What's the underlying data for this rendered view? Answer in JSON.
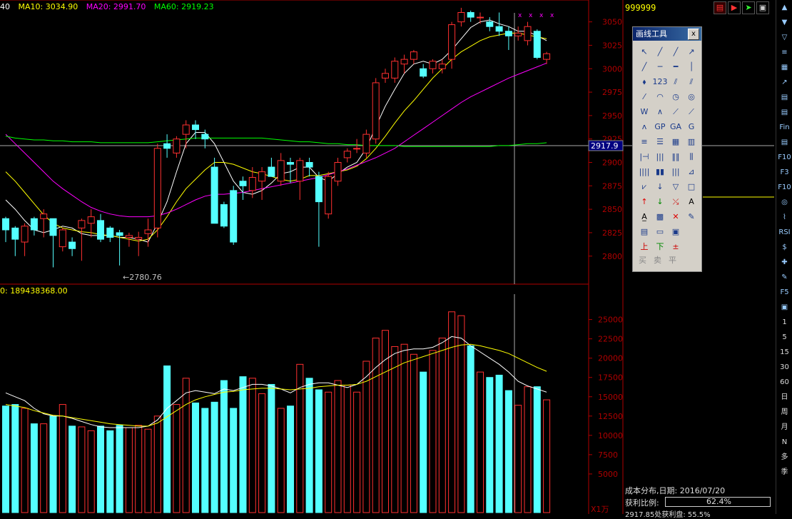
{
  "legend": {
    "ma5": "40",
    "ma10": "MA10: 3034.90",
    "ma20": "MA20: 2991.70",
    "ma60": "MA60: 2919.23"
  },
  "volume_legend": "0: 189438368.00",
  "code": "999999",
  "low_marker": "←2780.76",
  "crosshair_price": "2917.9",
  "colors": {
    "up": "#ff3030",
    "down": "#54ffff",
    "ma5": "#ffffff",
    "ma10": "#ffff00",
    "ma20": "#ff00ff",
    "ma60": "#00ff00",
    "axis": "#b00000"
  },
  "price_axis": [
    "3050",
    "3025",
    "3000",
    "2975",
    "2950",
    "2925",
    "2900",
    "2875",
    "2850",
    "2825",
    "2800"
  ],
  "volume_axis": [
    "25000",
    "22500",
    "20000",
    "17500",
    "15000",
    "12500",
    "10000",
    "7500",
    "5000"
  ],
  "volume_unit": "X1万",
  "drawtool": {
    "title": "画线工具",
    "close": "x",
    "tools": [
      "select-arrow",
      "line",
      "ray",
      "arrow-line",
      "segment",
      "h-line",
      "h-ray",
      "v-line",
      "point",
      "price-123",
      "parallel-lines",
      "parallel-channel",
      "dashed-line",
      "arc",
      "circle",
      "ellipse",
      "wave",
      "zigzag",
      "trend",
      "polyline",
      "wave-m",
      "gp",
      "ga",
      "gx",
      "fibo-retrace",
      "fibo-levels",
      "gann-fan",
      "gann-box",
      "time-cycle",
      "period-lines",
      "fibo-time",
      "fibo-fan",
      "bars",
      "barcode",
      "comb",
      "line-fan",
      "fan-lines",
      "down-arrow",
      "triangle",
      "rectangle",
      "up-arrow",
      "down-green-arrow",
      "flag-arrows",
      "text",
      "text-box",
      "block",
      "delete",
      "paint",
      "note",
      "panel",
      "picture",
      "blank",
      "buy-mark",
      "sell-mark",
      "equal-mark",
      "blank2"
    ],
    "labels": {
      "text": "A",
      "delete": "✕",
      "buy": "买",
      "sell": "卖",
      "flat": "平"
    }
  },
  "sidebar": [
    "▲",
    "▼",
    "▽",
    "≡",
    "▦",
    "↗",
    "▤",
    "▤",
    "Fin",
    "▤",
    "F10",
    "F3",
    "F10",
    "◎",
    "⌇",
    "RSI",
    "$",
    "✚",
    "✎",
    "F5",
    "▣",
    "1",
    "5",
    "15",
    "30",
    "60",
    "日",
    "周",
    "月",
    "N",
    "多",
    "季"
  ],
  "cost_info": {
    "label": "成本分布,日期: 2016/07/20",
    "ratio_label": "获利比例:",
    "ratio_value": "62.4%",
    "ratio_fraction": 0.624,
    "profit_line": "2917.85处获利盘: 55.5%"
  },
  "chart_data": {
    "type": "candlestick",
    "price_range": [
      2780,
      3060
    ],
    "volume_range": [
      0,
      27000
    ],
    "candles": [
      [
        2840,
        2842,
        2815,
        2828
      ],
      [
        2830,
        2832,
        2800,
        2818
      ],
      [
        2815,
        2835,
        2800,
        2832
      ],
      [
        2840,
        2842,
        2822,
        2828
      ],
      [
        2840,
        2850,
        2820,
        2845
      ],
      [
        2840,
        2840,
        2788,
        2822
      ],
      [
        2810,
        2830,
        2805,
        2828
      ],
      [
        2815,
        2820,
        2800,
        2808
      ],
      [
        2830,
        2840,
        2795,
        2838
      ],
      [
        2835,
        2850,
        2820,
        2842
      ],
      [
        2838,
        2845,
        2815,
        2818
      ],
      [
        2830,
        2832,
        2815,
        2820
      ],
      [
        2825,
        2828,
        2790,
        2822
      ],
      [
        2820,
        2825,
        2810,
        2822
      ],
      [
        2818,
        2826,
        2800,
        2820
      ],
      [
        2824,
        2840,
        2810,
        2828
      ],
      [
        2830,
        2920,
        2820,
        2915
      ],
      [
        2920,
        2930,
        2905,
        2915
      ],
      [
        2910,
        2928,
        2905,
        2925
      ],
      [
        2930,
        2945,
        2915,
        2940
      ],
      [
        2940,
        2945,
        2925,
        2935
      ],
      [
        2930,
        2935,
        2915,
        2925
      ],
      [
        2895,
        2905,
        2835,
        2835
      ],
      [
        2855,
        2858,
        2830,
        2832
      ],
      [
        2870,
        2875,
        2812,
        2815
      ],
      [
        2880,
        2885,
        2860,
        2875
      ],
      [
        2870,
        2895,
        2862,
        2884
      ],
      [
        2880,
        2895,
        2860,
        2890
      ],
      [
        2895,
        2905,
        2885,
        2885
      ],
      [
        2880,
        2910,
        2875,
        2902
      ],
      [
        2900,
        2905,
        2878,
        2898
      ],
      [
        2880,
        2905,
        2860,
        2902
      ],
      [
        2900,
        2905,
        2885,
        2895
      ],
      [
        2885,
        2890,
        2810,
        2858
      ],
      [
        2845,
        2890,
        2840,
        2885
      ],
      [
        2880,
        2905,
        2875,
        2900
      ],
      [
        2905,
        2915,
        2900,
        2912
      ],
      [
        2915,
        2925,
        2910,
        2915
      ],
      [
        2910,
        2935,
        2905,
        2930
      ],
      [
        2925,
        2990,
        2920,
        2985
      ],
      [
        2990,
        3000,
        2985,
        2995
      ],
      [
        2990,
        3012,
        2985,
        3008
      ],
      [
        3005,
        3015,
        2995,
        3010
      ],
      [
        3010,
        3020,
        3005,
        3018
      ],
      [
        3000,
        3005,
        2990,
        2992
      ],
      [
        3000,
        3010,
        2995,
        3008
      ],
      [
        3000,
        3010,
        2995,
        3005
      ],
      [
        3010,
        3050,
        3000,
        3047
      ],
      [
        3050,
        3065,
        3045,
        3060
      ],
      [
        3060,
        3062,
        3050,
        3055
      ],
      [
        3055,
        3060,
        3048,
        3055
      ],
      [
        3050,
        3055,
        3040,
        3045
      ],
      [
        3045,
        3060,
        3035,
        3040
      ],
      [
        3040,
        3045,
        3020,
        3035
      ],
      [
        3035,
        3045,
        3030,
        3038
      ],
      [
        3030,
        3050,
        3025,
        3045
      ],
      [
        3040,
        3042,
        3010,
        3012
      ],
      [
        3010,
        3018,
        3005,
        3016
      ]
    ],
    "volume": [
      13800,
      14000,
      13500,
      11500,
      11500,
      12500,
      14000,
      11200,
      11100,
      10600,
      11200,
      10600,
      11300,
      11000,
      11300,
      10800,
      12500,
      19000,
      14000,
      17400,
      14200,
      13500,
      14300,
      17100,
      13500,
      17600,
      17400,
      15400,
      16600,
      13500,
      13800,
      19200,
      17400,
      15900,
      15600,
      17100,
      16500,
      15600,
      19600,
      22600,
      23600,
      21500,
      21800,
      20500,
      18200,
      21000,
      22600,
      26000,
      25500,
      21600,
      18200,
      17500,
      17800,
      15800,
      13900,
      16300,
      16300,
      14600
    ],
    "ma5": [
      2860,
      2850,
      2838,
      2828,
      2825,
      2828,
      2832,
      2830,
      2824,
      2822,
      2822,
      2822,
      2820,
      2820,
      2818,
      2815,
      2835,
      2858,
      2890,
      2920,
      2932,
      2932,
      2920,
      2900,
      2880,
      2868,
      2866,
      2870,
      2878,
      2888,
      2890,
      2895,
      2895,
      2884,
      2880,
      2888,
      2895,
      2900,
      2915,
      2938,
      2960,
      2978,
      2995,
      3005,
      3008,
      3005,
      3010,
      3020,
      3032,
      3044,
      3050,
      3052,
      3048,
      3045,
      3040,
      3040,
      3035,
      3030
    ],
    "ma10": [
      2890,
      2880,
      2868,
      2856,
      2844,
      2835,
      2830,
      2828,
      2826,
      2825,
      2823,
      2822,
      2820,
      2818,
      2816,
      2818,
      2828,
      2842,
      2858,
      2872,
      2882,
      2892,
      2900,
      2900,
      2898,
      2894,
      2890,
      2888,
      2885,
      2882,
      2880,
      2882,
      2886,
      2886,
      2888,
      2890,
      2892,
      2896,
      2904,
      2915,
      2928,
      2942,
      2955,
      2966,
      2978,
      2990,
      3000,
      3010,
      3018,
      3024,
      3030,
      3034,
      3036,
      3038,
      3038,
      3036,
      3034,
      3032
    ],
    "ma20": [
      2930,
      2920,
      2910,
      2900,
      2890,
      2880,
      2872,
      2865,
      2858,
      2852,
      2848,
      2845,
      2843,
      2842,
      2842,
      2842,
      2843,
      2846,
      2850,
      2855,
      2860,
      2864,
      2866,
      2866,
      2867,
      2868,
      2870,
      2872,
      2874,
      2876,
      2878,
      2880,
      2882,
      2884,
      2887,
      2890,
      2893,
      2897,
      2901,
      2905,
      2910,
      2915,
      2922,
      2929,
      2936,
      2943,
      2950,
      2957,
      2964,
      2970,
      2975,
      2980,
      2985,
      2990,
      2994,
      2998,
      3002,
      3006
    ],
    "ma60": [
      2928,
      2926,
      2925,
      2924,
      2924,
      2923,
      2923,
      2922,
      2922,
      2922,
      2921,
      2921,
      2921,
      2921,
      2921,
      2921,
      2922,
      2923,
      2924,
      2925,
      2926,
      2926,
      2926,
      2926,
      2926,
      2926,
      2926,
      2926,
      2925,
      2924,
      2923,
      2922,
      2922,
      2921,
      2920,
      2920,
      2919,
      2919,
      2918,
      2918,
      2918,
      2918,
      2917,
      2917,
      2917,
      2917,
      2917,
      2917,
      2917,
      2917,
      2917,
      2917,
      2918,
      2918,
      2919,
      2920,
      2920,
      2921
    ],
    "vol_ma1": [
      15500,
      15000,
      14500,
      13500,
      12800,
      12500,
      12500,
      12200,
      11800,
      11400,
      11100,
      11000,
      11000,
      11000,
      11000,
      11200,
      12000,
      13500,
      14500,
      15500,
      15800,
      15600,
      15400,
      16000,
      15800,
      16200,
      16600,
      16600,
      16400,
      16000,
      15500,
      16200,
      16600,
      16800,
      16800,
      16500,
      16200,
      16600,
      17600,
      18800,
      19800,
      20600,
      21000,
      21200,
      21200,
      21400,
      22000,
      22800,
      22600,
      21600,
      20800,
      20000,
      19200,
      18200,
      17000,
      16400,
      16000,
      15600
    ],
    "vol_ma2": [
      14000,
      13800,
      13600,
      13200,
      12900,
      12600,
      12500,
      12300,
      12100,
      11900,
      11700,
      11500,
      11400,
      11300,
      11200,
      11200,
      11600,
      12400,
      13200,
      14000,
      14600,
      15000,
      15300,
      15600,
      15700,
      15900,
      16000,
      16100,
      16100,
      16000,
      15900,
      16000,
      16100,
      16300,
      16400,
      16500,
      16500,
      16600,
      17000,
      17600,
      18200,
      18800,
      19400,
      19800,
      20200,
      20600,
      21000,
      21400,
      21700,
      21800,
      21600,
      21300,
      21000,
      20600,
      20000,
      19400,
      18800,
      18300
    ]
  }
}
